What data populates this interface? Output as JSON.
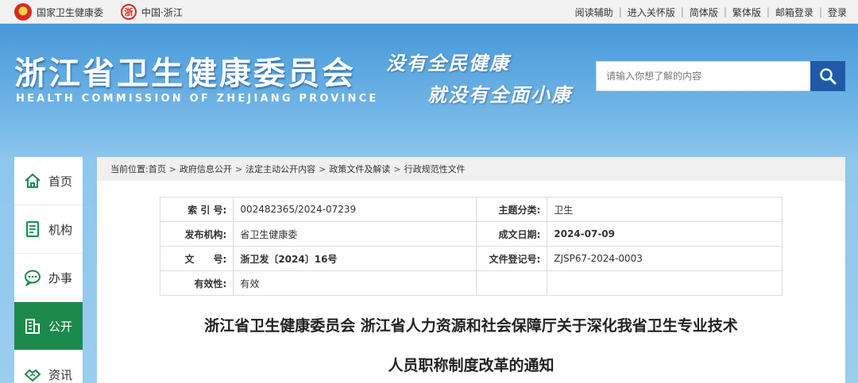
{
  "topbar": {
    "national_link": "国家卫生健康委",
    "zhejiang_link": "中国·浙江",
    "links": [
      "阅读辅助",
      "进入关怀版",
      "简体版",
      "繁体版",
      "邮箱登录",
      "登录"
    ]
  },
  "header": {
    "title": "浙江省卫生健康委员会",
    "subtitle": "HEALTH COMMISSION OF ZHEJIANG PROVINCE",
    "slogan_line1": "没有全民健康",
    "slogan_line2": "就没有全面小康",
    "search_placeholder": "请输入你想了解的内容"
  },
  "sidebar": {
    "items": [
      {
        "label": "首页",
        "icon": "home-icon",
        "active": false
      },
      {
        "label": "机构",
        "icon": "org-icon",
        "active": false
      },
      {
        "label": "办事",
        "icon": "chat-icon",
        "active": false
      },
      {
        "label": "公开",
        "icon": "building-icon",
        "active": true
      },
      {
        "label": "资讯",
        "icon": "handshake-icon",
        "active": false
      }
    ]
  },
  "breadcrumb": {
    "prefix": "当前位置:",
    "items": [
      "首页",
      "政府信息公开",
      "法定主动公开内容",
      "政策文件及解读",
      "行政规范性文件"
    ]
  },
  "meta": {
    "rows": [
      {
        "k1": "索 引 号:",
        "v1": "002482365/2024-07239",
        "k2": "主题分类:",
        "v2": "卫生"
      },
      {
        "k1": "发布机构:",
        "v1": "省卫生健康委",
        "k2": "成文日期:",
        "v2": "2024-07-09"
      },
      {
        "k1": "文　　号:",
        "v1": "浙卫发〔2024〕16号",
        "k2": "文件登记号:",
        "v2": "ZJSP67-2024-0003"
      },
      {
        "k1": "有效性:",
        "v1": "有效",
        "k2": "",
        "v2": ""
      }
    ]
  },
  "document": {
    "title_line1": "浙江省卫生健康委员会 浙江省人力资源和社会保障厅关于深化我省卫生专业技术",
    "title_line2": "人员职称制度改革的通知"
  },
  "colors": {
    "accent_green": "#1b8a4a",
    "search_blue": "#1f5aa7"
  }
}
